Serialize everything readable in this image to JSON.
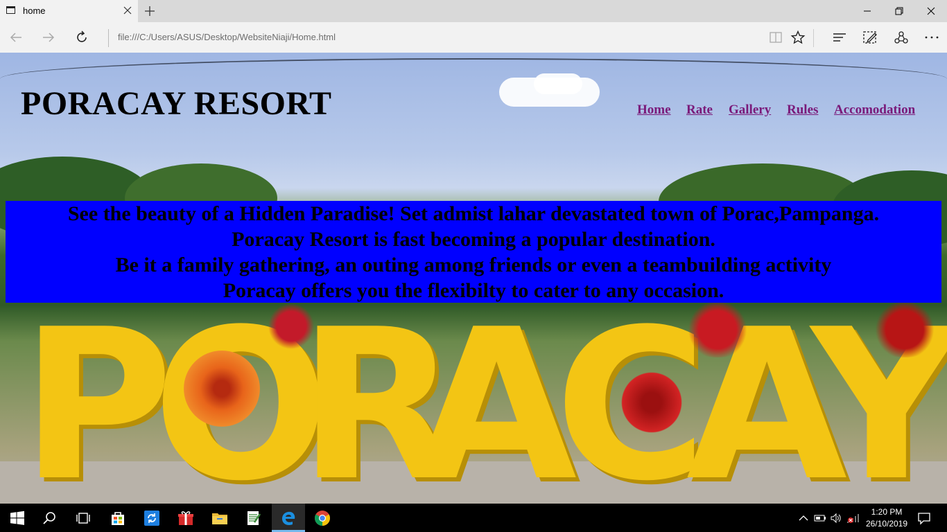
{
  "browser": {
    "tab_title": "home",
    "address": "file:///C:/Users/ASUS/Desktop/WebsiteNiaji/Home.html"
  },
  "site": {
    "title": "PORACAY RESORT",
    "nav": [
      "Home",
      "Rate",
      "Gallery",
      "Rules",
      "Accomodation"
    ],
    "banner_lines": [
      "See the beauty of a Hidden Paradise! Set admist lahar devastated town of Porac,Pampanga.",
      "Poracay Resort is fast becoming a popular destination.",
      "Be it a family gathering, an outing among friends or even a teambuilding activity",
      "Poracay offers you the flexibilty to cater to any occasion."
    ],
    "hero_sign": [
      "P",
      "O",
      "R",
      "A",
      "C",
      "A",
      "Y"
    ]
  },
  "taskbar": {
    "time": "1:20 PM",
    "date": "26/10/2019"
  },
  "colors": {
    "banner_bg": "#0000ff",
    "nav_link": "#7a1a7a",
    "sign_yellow": "#f3c514",
    "taskbar_bg": "#000000"
  }
}
